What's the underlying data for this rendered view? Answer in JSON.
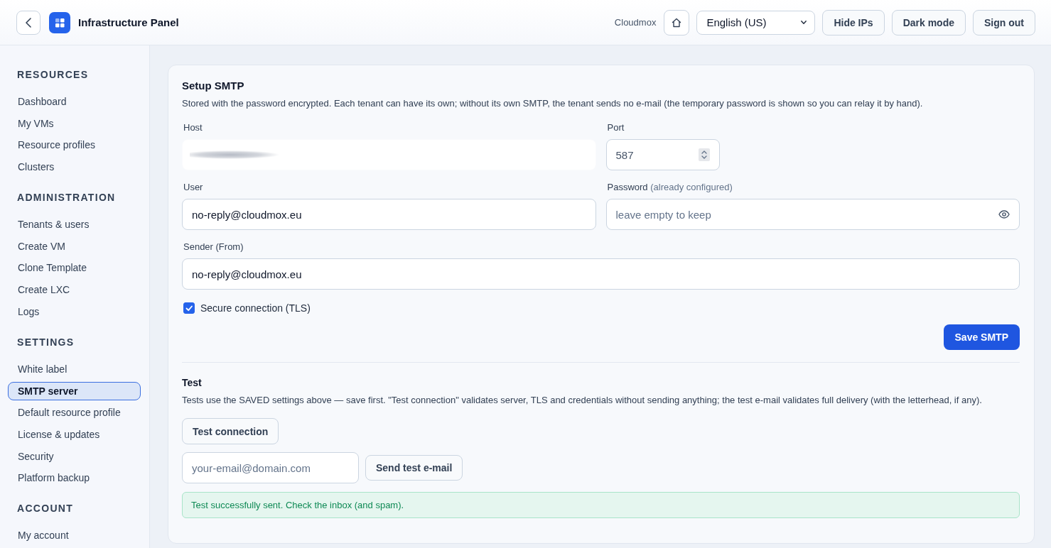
{
  "header": {
    "title": "Infrastructure Panel",
    "brand": "Cloudmox",
    "language": "English (US)",
    "buttons": [
      {
        "label": "Hide IPs"
      },
      {
        "label": "Dark mode"
      },
      {
        "label": "Sign out"
      }
    ]
  },
  "sidebar": {
    "sections": [
      {
        "heading": "RESOURCES",
        "items": [
          {
            "label": "Dashboard",
            "selected": false
          },
          {
            "label": "My VMs",
            "selected": false
          },
          {
            "label": "Resource profiles",
            "selected": false
          },
          {
            "label": "Clusters",
            "selected": false
          }
        ]
      },
      {
        "heading": "ADMINISTRATION",
        "items": [
          {
            "label": "Tenants & users",
            "selected": false
          },
          {
            "label": "Create VM",
            "selected": false
          },
          {
            "label": "Clone Template",
            "selected": false
          },
          {
            "label": "Create LXC",
            "selected": false
          },
          {
            "label": "Logs",
            "selected": false
          }
        ]
      },
      {
        "heading": "SETTINGS",
        "items": [
          {
            "label": "White label",
            "selected": false
          },
          {
            "label": "SMTP server",
            "selected": true
          },
          {
            "label": "Default resource profile",
            "selected": false
          },
          {
            "label": "License & updates",
            "selected": false
          },
          {
            "label": "Security",
            "selected": false
          },
          {
            "label": "Platform backup",
            "selected": false
          }
        ]
      },
      {
        "heading": "ACCOUNT",
        "items": [
          {
            "label": "My account",
            "selected": false
          }
        ]
      }
    ]
  },
  "smtp": {
    "title": "Setup SMTP",
    "description": "Stored with the password encrypted. Each tenant can have its own; without its own SMTP, the tenant sends no e-mail (the temporary password is shown so you can relay it by hand).",
    "rows": [
      [
        {
          "kind": "blurred",
          "label": "Host"
        },
        {
          "kind": "number",
          "label": "Port",
          "value": "587"
        }
      ],
      [
        {
          "kind": "text",
          "label": "User",
          "value": "no-reply@cloudmox.eu"
        },
        {
          "kind": "password",
          "label": "Password",
          "note": "(already configured)",
          "placeholder": "leave empty to keep"
        }
      ],
      [
        {
          "kind": "text",
          "label": "Sender (From)",
          "value": "no-reply@cloudmox.eu"
        }
      ]
    ],
    "tls": {
      "label": "Secure connection (TLS)",
      "checked": true
    },
    "save_button": "Save SMTP"
  },
  "test": {
    "title": "Test",
    "description": "Tests use the SAVED settings above — save first. \"Test connection\" validates server, TLS and credentials without sending anything; the test e-mail validates full delivery (with the letterhead, if any).",
    "connection_button": "Test connection",
    "email_field": {
      "placeholder": "your-email@domain.com"
    },
    "send_button": "Send test e-mail",
    "alert": {
      "kind": "success",
      "text": "Test successfully sent. Check the inbox (and spam)."
    }
  }
}
